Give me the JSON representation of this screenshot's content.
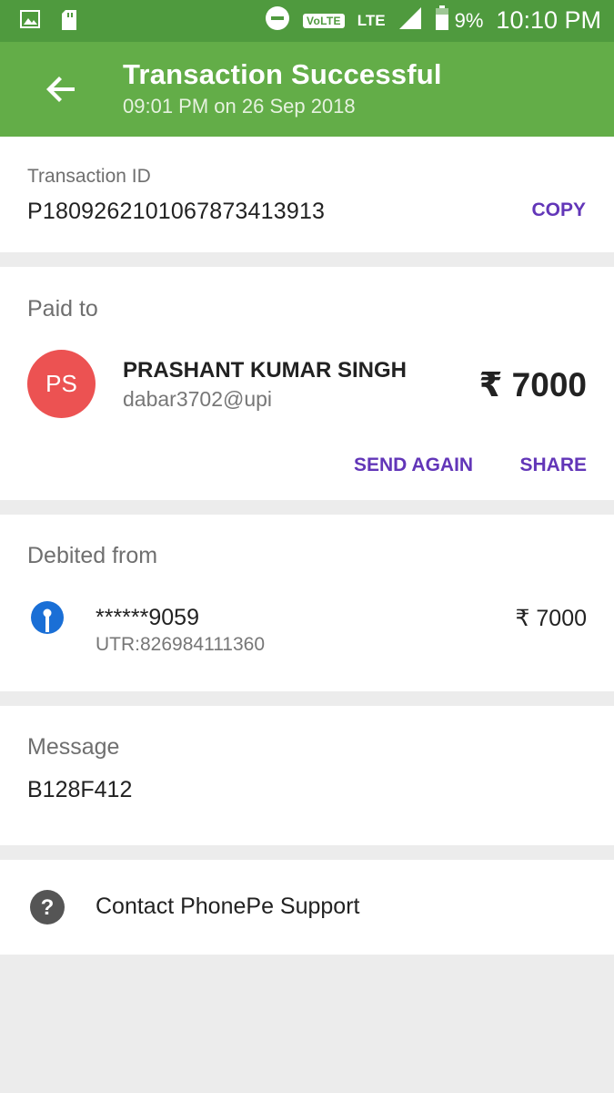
{
  "status_bar": {
    "volte": "VoLTE",
    "network": "LTE",
    "battery": "9%",
    "time": "10:10 PM"
  },
  "header": {
    "title": "Transaction Successful",
    "subtitle": "09:01 PM on 26 Sep 2018"
  },
  "transaction": {
    "label": "Transaction ID",
    "id": "P1809262101067873413913",
    "copy_label": "COPY"
  },
  "paid_to": {
    "label": "Paid to",
    "initials": "PS",
    "name": "PRASHANT KUMAR SINGH",
    "upi": "dabar3702@upi",
    "amount": "₹ 7000",
    "send_again_label": "SEND AGAIN",
    "share_label": "SHARE"
  },
  "debited_from": {
    "label": "Debited from",
    "account": "******9059",
    "utr": "UTR:826984111360",
    "amount": "₹ 7000"
  },
  "message": {
    "label": "Message",
    "text": "B128F412"
  },
  "support": {
    "label": "Contact PhonePe Support"
  },
  "colors": {
    "status_bar": "#4f9a3e",
    "app_bar": "#63ad48",
    "accent": "#6236b8",
    "avatar": "#ec5252",
    "bank_icon": "#1a6fd6"
  }
}
